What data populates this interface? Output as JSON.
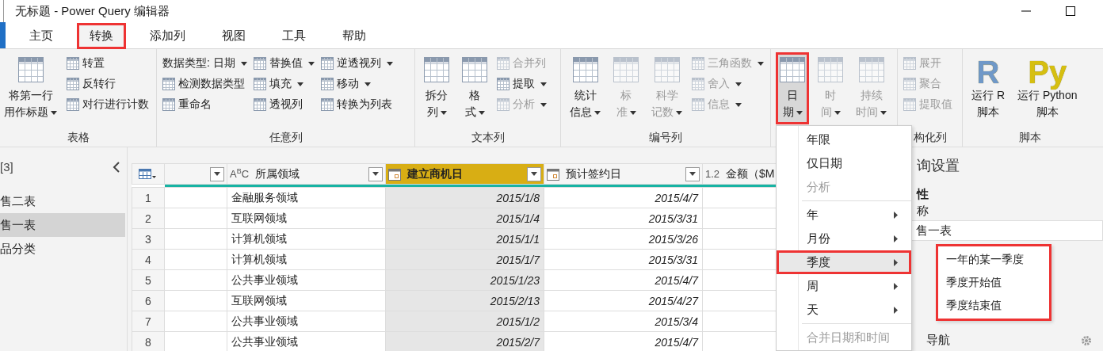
{
  "window": {
    "title": "无标题 - Power Query 编辑器"
  },
  "tabs": [
    {
      "label": "主页",
      "selected": false,
      "highlighted": false
    },
    {
      "label": "转换",
      "selected": true,
      "highlighted": true
    },
    {
      "label": "添加列",
      "selected": false,
      "highlighted": false
    },
    {
      "label": "视图",
      "selected": false,
      "highlighted": false
    },
    {
      "label": "工具",
      "selected": false,
      "highlighted": false
    },
    {
      "label": "帮助",
      "selected": false,
      "highlighted": false
    }
  ],
  "ribbon": {
    "groups": [
      {
        "label": "表格",
        "items": [
          {
            "kind": "large",
            "lines": [
              "将第一行",
              "用作标题"
            ],
            "dropdown": true,
            "disabled": false,
            "pressed": false,
            "highlighted": false
          },
          {
            "kind": "stack",
            "buttons": [
              {
                "label": "转置",
                "dropdown": false,
                "disabled": false
              },
              {
                "label": "反转行",
                "dropdown": false,
                "disabled": false
              },
              {
                "label": "对行进行计数",
                "dropdown": false,
                "disabled": false
              }
            ]
          }
        ]
      },
      {
        "label": "任意列",
        "items": [
          {
            "kind": "stack",
            "buttons": [
              {
                "label": "数据类型: 日期",
                "dropdown": true,
                "disabled": false,
                "plain": true
              },
              {
                "label": "检测数据类型",
                "dropdown": false,
                "disabled": false
              },
              {
                "label": "重命名",
                "dropdown": false,
                "disabled": false
              }
            ]
          },
          {
            "kind": "stack",
            "buttons": [
              {
                "label": "替换值",
                "dropdown": true,
                "disabled": false
              },
              {
                "label": "填充",
                "dropdown": true,
                "disabled": false
              },
              {
                "label": "透视列",
                "dropdown": false,
                "disabled": false
              }
            ]
          },
          {
            "kind": "stack",
            "buttons": [
              {
                "label": "逆透视列",
                "dropdown": true,
                "disabled": false
              },
              {
                "label": "移动",
                "dropdown": true,
                "disabled": false
              },
              {
                "label": "转换为列表",
                "dropdown": false,
                "disabled": false
              }
            ]
          }
        ]
      },
      {
        "label": "文本列",
        "items": [
          {
            "kind": "large",
            "lines": [
              "拆分",
              "列"
            ],
            "dropdown": true,
            "disabled": false,
            "pressed": false,
            "highlighted": false
          },
          {
            "kind": "large",
            "lines": [
              "格",
              "式"
            ],
            "dropdown": true,
            "disabled": false,
            "pressed": false,
            "highlighted": false
          },
          {
            "kind": "stack",
            "buttons": [
              {
                "label": "合并列",
                "dropdown": false,
                "disabled": true
              },
              {
                "label": "提取",
                "dropdown": true,
                "disabled": false
              },
              {
                "label": "分析",
                "dropdown": true,
                "disabled": true
              }
            ]
          }
        ]
      },
      {
        "label": "编号列",
        "items": [
          {
            "kind": "large",
            "lines": [
              "统计",
              "信息"
            ],
            "dropdown": true,
            "disabled": false,
            "pressed": false,
            "highlighted": false
          },
          {
            "kind": "large",
            "lines": [
              "标",
              "准"
            ],
            "dropdown": true,
            "disabled": true,
            "pressed": false,
            "highlighted": false
          },
          {
            "kind": "large",
            "lines": [
              "科学",
              "记数"
            ],
            "dropdown": true,
            "disabled": true,
            "pressed": false,
            "highlighted": false
          },
          {
            "kind": "stack",
            "buttons": [
              {
                "label": "三角函数",
                "dropdown": true,
                "disabled": true
              },
              {
                "label": "舍入",
                "dropdown": true,
                "disabled": true
              },
              {
                "label": "信息",
                "dropdown": true,
                "disabled": true
              }
            ]
          }
        ]
      },
      {
        "items": [
          {
            "kind": "large",
            "lines": [
              "日",
              "期"
            ],
            "dropdown": true,
            "disabled": false,
            "pressed": true,
            "highlighted": true
          },
          {
            "kind": "large",
            "lines": [
              "时",
              "间"
            ],
            "dropdown": true,
            "disabled": true,
            "pressed": false,
            "highlighted": false
          },
          {
            "kind": "large",
            "lines": [
              "持续",
              "时间"
            ],
            "dropdown": true,
            "disabled": true,
            "pressed": false,
            "highlighted": false
          }
        ]
      },
      {
        "label": "构化列",
        "items": [
          {
            "kind": "stack",
            "buttons": [
              {
                "label": "展开",
                "dropdown": false,
                "disabled": true
              },
              {
                "label": "聚合",
                "dropdown": false,
                "disabled": true
              },
              {
                "label": "提取值",
                "dropdown": false,
                "disabled": true
              }
            ]
          }
        ]
      },
      {
        "label": "脚本",
        "items": [
          {
            "kind": "large",
            "glyph": "R",
            "color": "#6f98c8",
            "lines": [
              "运行 R",
              "脚本"
            ],
            "dropdown": false,
            "disabled": false,
            "pressed": false,
            "highlighted": false
          },
          {
            "kind": "large",
            "glyph": "Py",
            "color": "#d6bf10",
            "lines": [
              "运行 Python",
              "脚本"
            ],
            "dropdown": false,
            "disabled": false,
            "pressed": false,
            "highlighted": false
          }
        ]
      }
    ]
  },
  "queries": {
    "count": "[3]",
    "items": [
      {
        "label": "售二表",
        "selected": false
      },
      {
        "label": "售一表",
        "selected": true
      },
      {
        "label": "品分类",
        "selected": false
      }
    ]
  },
  "table": {
    "columns": [
      {
        "kind": "blank",
        "filter": true,
        "selected": false
      },
      {
        "kind": "text",
        "type_label": "A$^{B}$C",
        "label": "所属领域",
        "filter": true,
        "selected": false
      },
      {
        "kind": "date",
        "label": "建立商机日",
        "filter": true,
        "selected": true
      },
      {
        "kind": "date",
        "label": "预计签约日",
        "filter": true,
        "selected": false
      },
      {
        "kind": "number",
        "type_label": "1.2",
        "label": "金额（$M",
        "filter": false,
        "selected": false
      }
    ],
    "rows": [
      {
        "number": "1",
        "domain": "金融服务领域",
        "created": "2015/1/8",
        "expected": "2015/4/7"
      },
      {
        "number": "2",
        "domain": "互联网领域",
        "created": "2015/1/4",
        "expected": "2015/3/31"
      },
      {
        "number": "3",
        "domain": "计算机领域",
        "created": "2015/1/1",
        "expected": "2015/3/26"
      },
      {
        "number": "4",
        "domain": "计算机领域",
        "created": "2015/1/7",
        "expected": "2015/3/31"
      },
      {
        "number": "5",
        "domain": "公共事业领域",
        "created": "2015/1/23",
        "expected": "2015/4/7"
      },
      {
        "number": "6",
        "domain": "互联网领域",
        "created": "2015/2/13",
        "expected": "2015/4/27"
      },
      {
        "number": "7",
        "domain": "公共事业领域",
        "created": "2015/1/2",
        "expected": "2015/3/4"
      },
      {
        "number": "8",
        "domain": "公共事业领域",
        "created": "2015/2/7",
        "expected": "2015/4/7"
      }
    ]
  },
  "settings": {
    "title": "询设置",
    "section": "性",
    "name_label": "称",
    "name_value": "售一表",
    "steps": [
      {
        "label": "导航",
        "settings": true
      }
    ]
  },
  "menu": {
    "items": [
      {
        "kind": "item",
        "label": "年限",
        "disabled": false,
        "submenu": false,
        "hovered": false,
        "highlighted": false
      },
      {
        "kind": "item",
        "label": "仅日期",
        "disabled": false,
        "submenu": false,
        "hovered": false,
        "highlighted": false
      },
      {
        "kind": "item",
        "label": "分析",
        "disabled": true,
        "submenu": false,
        "hovered": false,
        "highlighted": false
      },
      {
        "kind": "separator"
      },
      {
        "kind": "item",
        "label": "年",
        "disabled": false,
        "submenu": true,
        "hovered": false,
        "highlighted": false
      },
      {
        "kind": "item",
        "label": "月份",
        "disabled": false,
        "submenu": true,
        "hovered": false,
        "highlighted": false
      },
      {
        "kind": "item",
        "label": "季度",
        "disabled": false,
        "submenu": true,
        "hovered": true,
        "highlighted": true
      },
      {
        "kind": "item",
        "label": "周",
        "disabled": false,
        "submenu": true,
        "hovered": false,
        "highlighted": false
      },
      {
        "kind": "item",
        "label": "天",
        "disabled": false,
        "submenu": true,
        "hovered": false,
        "highlighted": false
      },
      {
        "kind": "separator"
      },
      {
        "kind": "item",
        "label": "合并日期和时间",
        "disabled": true,
        "submenu": false,
        "hovered": false,
        "highlighted": false
      }
    ]
  },
  "submenu": {
    "highlighted": true,
    "items": [
      {
        "label": "一年的某一季度"
      },
      {
        "label": "季度开始值"
      },
      {
        "label": "季度结束值"
      }
    ]
  }
}
